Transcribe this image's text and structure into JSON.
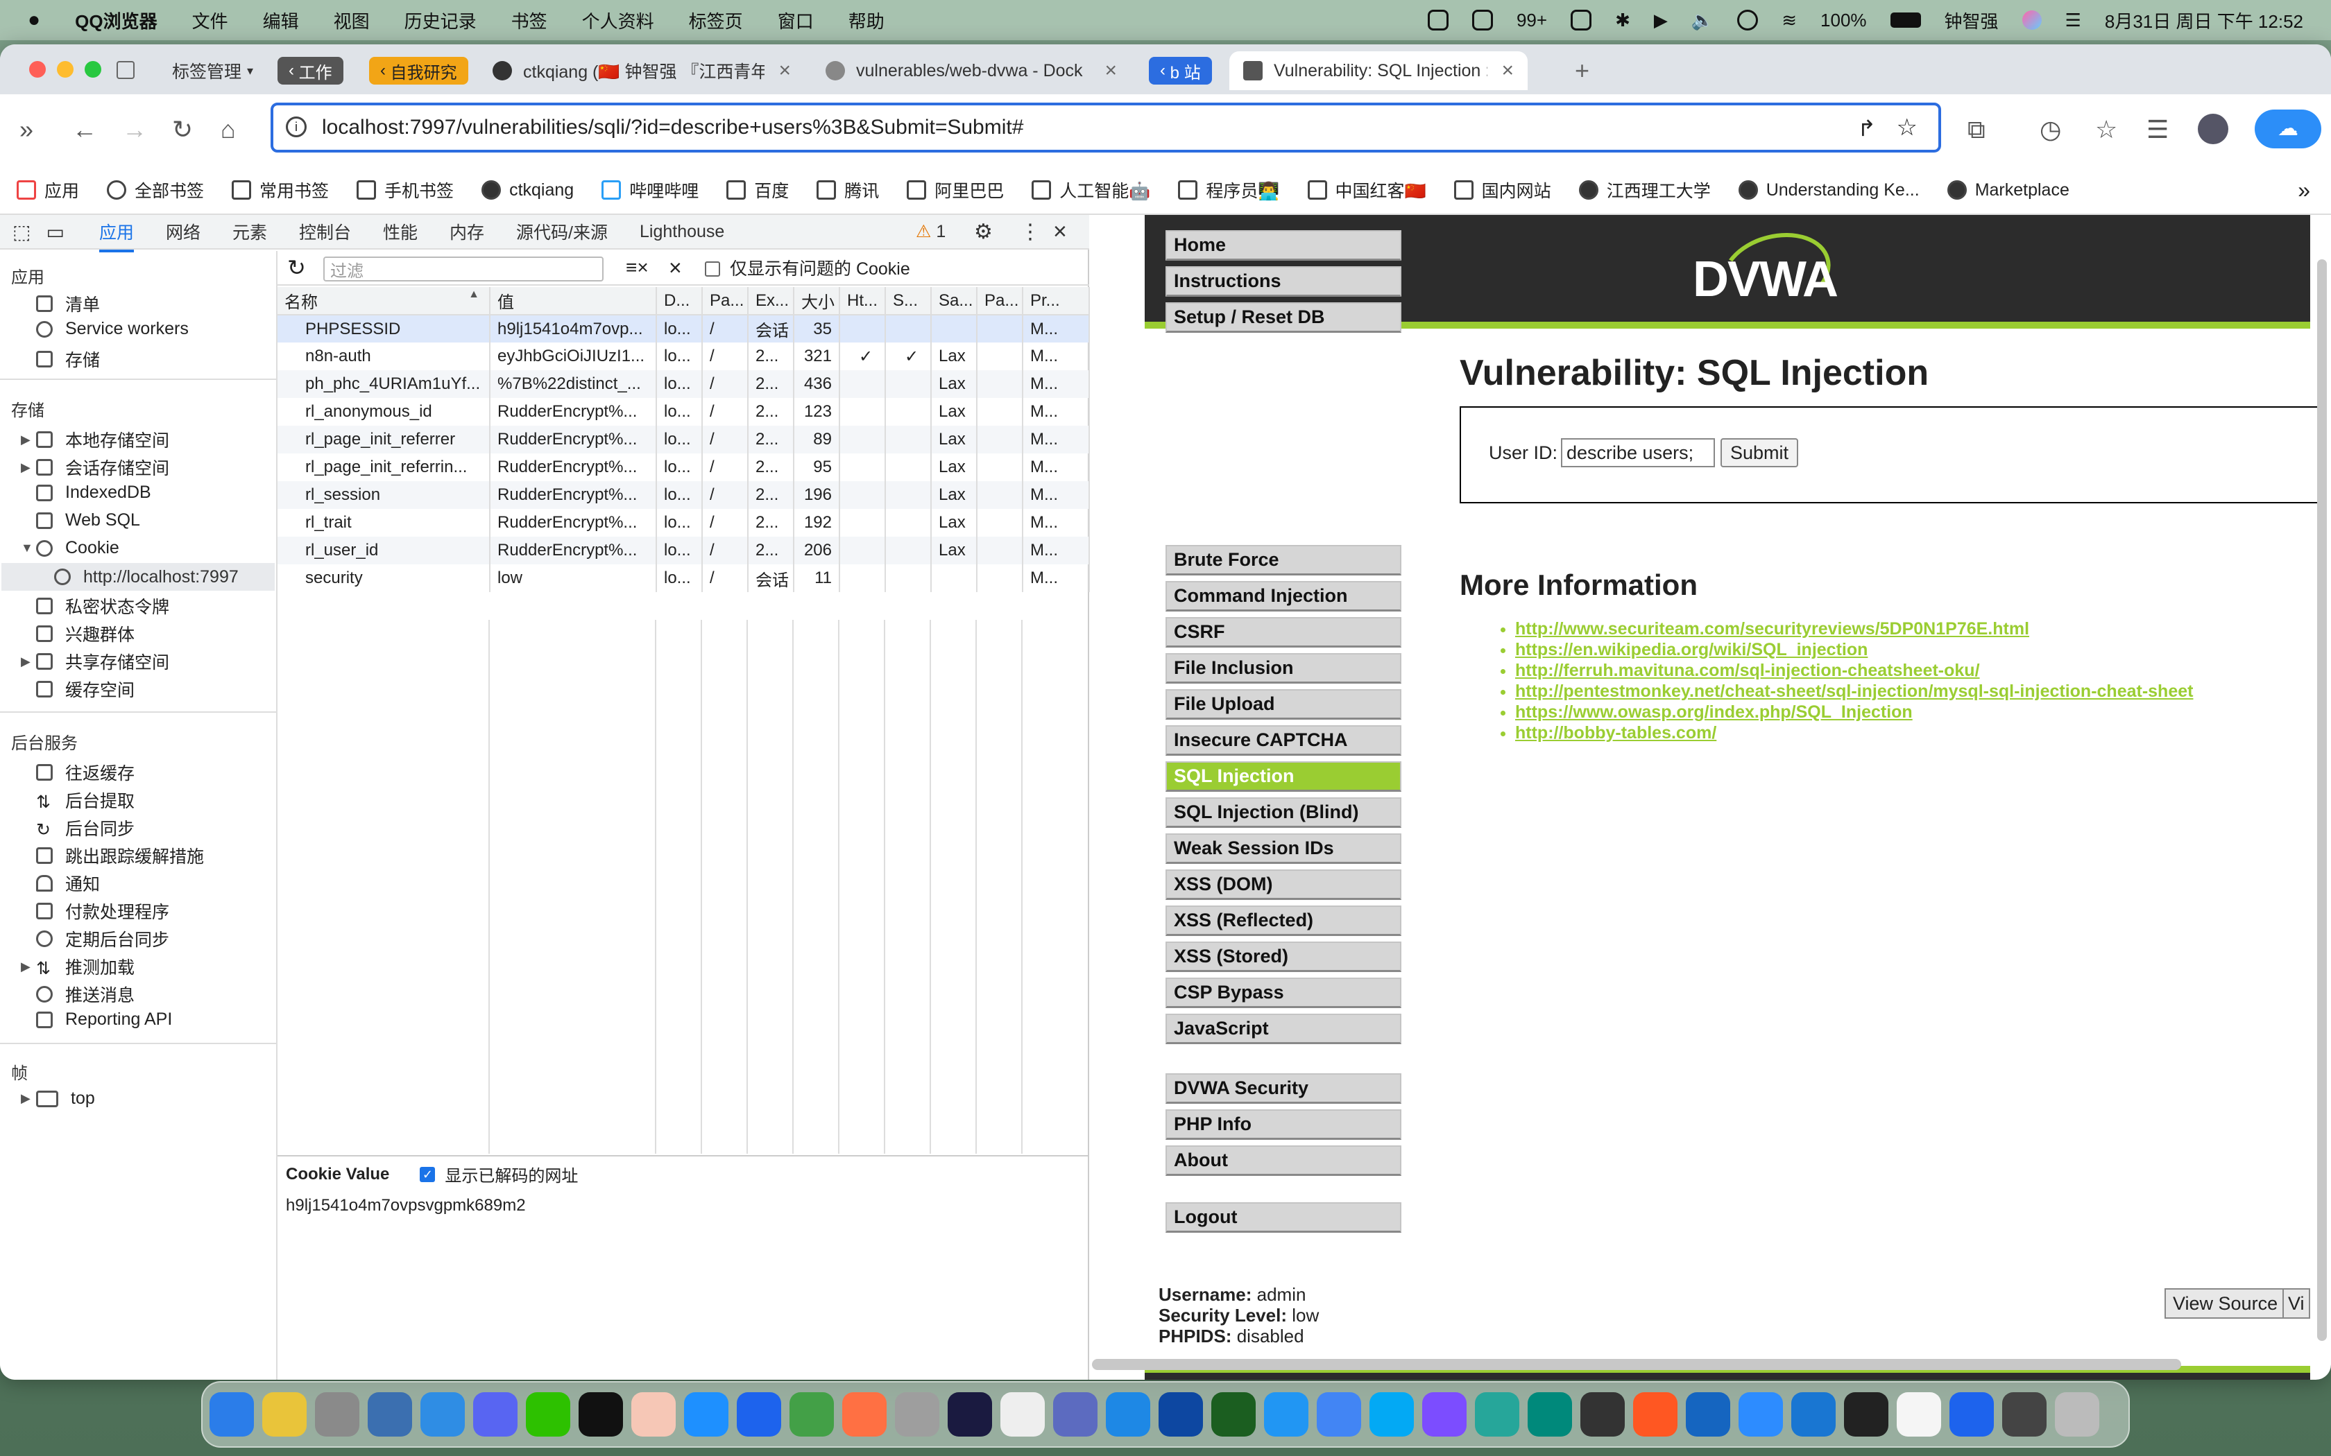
{
  "menubar": {
    "app": "QQ浏览器",
    "items": [
      "文件",
      "编辑",
      "视图",
      "历史记录",
      "书签",
      "个人资料",
      "标签页",
      "窗口",
      "帮助"
    ],
    "notifications": "99+",
    "battery": "100%",
    "user": "钟智强",
    "datetime": "8月31日 周日 下午 12:52"
  },
  "tabbar": {
    "manage": "标签管理",
    "group_work": "工作",
    "group_research": "自我研究",
    "tabs": [
      {
        "title": "ctkqiang (🇨🇳 钟智强 『江西青年"
      },
      {
        "title": "vulnerables/web-dvwa - Dock"
      },
      {
        "title": "b 站"
      },
      {
        "title": "Vulnerability: SQL Injection ::"
      }
    ]
  },
  "address": {
    "url": "localhost:7997/vulnerabilities/sqli/?id=describe+users%3B&Submit=Submit#"
  },
  "bookmarks": [
    "应用",
    "全部书签",
    "常用书签",
    "手机书签",
    "ctkqiang",
    "哔哩哔哩",
    "百度",
    "腾讯",
    "阿里巴巴",
    "人工智能🤖",
    "程序员👨‍💻",
    "中国红客🇨🇳",
    "国内网站",
    "江西理工大学",
    "Understanding Ke...",
    "Marketplace"
  ],
  "devtools": {
    "tabs": [
      "应用",
      "网络",
      "元素",
      "控制台",
      "性能",
      "内存",
      "源代码/来源",
      "Lighthouse"
    ],
    "active_tab": "应用",
    "issues": "1",
    "sidebar": {
      "app_header": "应用",
      "app_items": [
        "清单",
        "Service workers",
        "存储"
      ],
      "storage_header": "存储",
      "storage_items": [
        "本地存储空间",
        "会话存储空间",
        "IndexedDB",
        "Web SQL",
        "Cookie"
      ],
      "cookie_origin": "http://localhost:7997",
      "storage_items2": [
        "私密状态令牌",
        "兴趣群体",
        "共享存储空间",
        "缓存空间"
      ],
      "bg_header": "后台服务",
      "bg_items": [
        "往返缓存",
        "后台提取",
        "后台同步",
        "跳出跟踪缓解措施",
        "通知",
        "付款处理程序",
        "定期后台同步",
        "推测加载",
        "推送消息",
        "Reporting API"
      ],
      "frames_header": "帧",
      "frame_top": "top"
    },
    "filter_placeholder": "过滤",
    "only_issues_label": "仅显示有问题的 Cookie",
    "columns": [
      "名称",
      "值",
      "D...",
      "Pa...",
      "Ex...",
      "大小",
      "Ht...",
      "S...",
      "Sa...",
      "Pa...",
      "Pr..."
    ],
    "cookies": [
      [
        "PHPSESSID",
        "h9lj1541o4m7ovp...",
        "lo...",
        "/",
        "会话",
        "35",
        "",
        "",
        "",
        "",
        "M..."
      ],
      [
        "n8n-auth",
        "eyJhbGciOiJIUzI1...",
        "lo...",
        "/",
        "2...",
        "321",
        "✓",
        "✓",
        "Lax",
        "",
        "M..."
      ],
      [
        "ph_phc_4URIAm1uYf...",
        "%7B%22distinct_...",
        "lo...",
        "/",
        "2...",
        "436",
        "",
        "",
        "Lax",
        "",
        "M..."
      ],
      [
        "rl_anonymous_id",
        "RudderEncrypt%...",
        "lo...",
        "/",
        "2...",
        "123",
        "",
        "",
        "Lax",
        "",
        "M..."
      ],
      [
        "rl_page_init_referrer",
        "RudderEncrypt%...",
        "lo...",
        "/",
        "2...",
        "89",
        "",
        "",
        "Lax",
        "",
        "M..."
      ],
      [
        "rl_page_init_referrin...",
        "RudderEncrypt%...",
        "lo...",
        "/",
        "2...",
        "95",
        "",
        "",
        "Lax",
        "",
        "M..."
      ],
      [
        "rl_session",
        "RudderEncrypt%...",
        "lo...",
        "/",
        "2...",
        "196",
        "",
        "",
        "Lax",
        "",
        "M..."
      ],
      [
        "rl_trait",
        "RudderEncrypt%...",
        "lo...",
        "/",
        "2...",
        "192",
        "",
        "",
        "Lax",
        "",
        "M..."
      ],
      [
        "rl_user_id",
        "RudderEncrypt%...",
        "lo...",
        "/",
        "2...",
        "206",
        "",
        "",
        "Lax",
        "",
        "M..."
      ],
      [
        "security",
        "low",
        "lo...",
        "/",
        "会话",
        "11",
        "",
        "",
        "",
        "",
        "M..."
      ]
    ],
    "cookie_value_label": "Cookie Value",
    "show_decoded_label": "显示已解码的网址",
    "cookie_value": "h9lj1541o4m7ovpsvgpmk689m2"
  },
  "dvwa": {
    "logo": "DVWA",
    "menu1": [
      "Home",
      "Instructions",
      "Setup / Reset DB"
    ],
    "menu2": [
      "Brute Force",
      "Command Injection",
      "CSRF",
      "File Inclusion",
      "File Upload",
      "Insecure CAPTCHA",
      "SQL Injection",
      "SQL Injection (Blind)",
      "Weak Session IDs",
      "XSS (DOM)",
      "XSS (Reflected)",
      "XSS (Stored)",
      "CSP Bypass",
      "JavaScript"
    ],
    "menu3": [
      "DVWA Security",
      "PHP Info",
      "About"
    ],
    "menu4": [
      "Logout"
    ],
    "active": "SQL Injection",
    "title": "Vulnerability: SQL Injection",
    "userid_label": "User ID:",
    "userid_value": "describe users;",
    "submit": "Submit",
    "more_info": "More Information",
    "links": [
      "http://www.securiteam.com/securityreviews/5DP0N1P76E.html",
      "https://en.wikipedia.org/wiki/SQL_injection",
      "http://ferruh.mavituna.com/sql-injection-cheatsheet-oku/",
      "http://pentestmonkey.net/cheat-sheet/sql-injection/mysql-sql-injection-cheat-sheet",
      "https://www.owasp.org/index.php/SQL_Injection",
      "http://bobby-tables.com/"
    ],
    "status": {
      "username_label": "Username:",
      "username": "admin",
      "security_label": "Security Level:",
      "security": "low",
      "phpids_label": "PHPIDS:",
      "phpids": "disabled"
    },
    "view_source": "View Source",
    "view_help": "Vi"
  },
  "colors": {
    "accent": "#1a73e8",
    "dvwa_green": "#9acd32",
    "dvwa_dark": "#2c2c2c"
  }
}
